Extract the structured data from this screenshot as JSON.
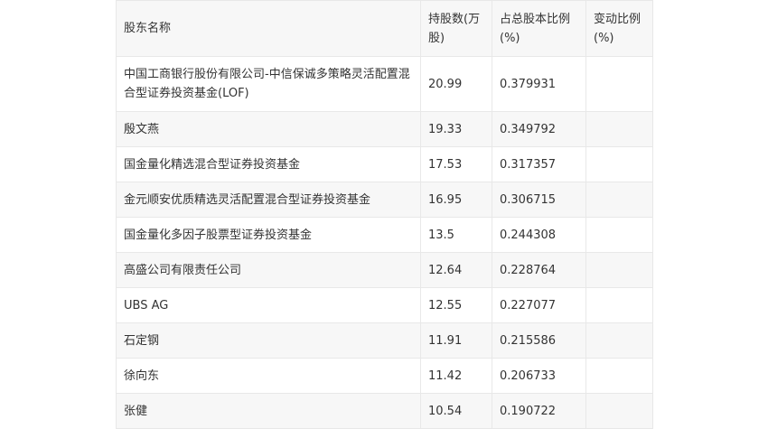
{
  "table": {
    "headers": [
      "股东名称",
      "持股数(万股)",
      "占总股本比例(%)",
      "变动比例(%)"
    ],
    "rows": [
      {
        "name": "中国工商银行股份有限公司-中信保诚多策略灵活配置混合型证券投资基金(LOF)",
        "shares": "20.99",
        "ratio": "0.379931",
        "change": ""
      },
      {
        "name": "殷文燕",
        "shares": "19.33",
        "ratio": "0.349792",
        "change": ""
      },
      {
        "name": "国金量化精选混合型证券投资基金",
        "shares": "17.53",
        "ratio": "0.317357",
        "change": ""
      },
      {
        "name": "金元顺安优质精选灵活配置混合型证券投资基金",
        "shares": "16.95",
        "ratio": "0.306715",
        "change": ""
      },
      {
        "name": "国金量化多因子股票型证券投资基金",
        "shares": "13.5",
        "ratio": "0.244308",
        "change": ""
      },
      {
        "name": "高盛公司有限责任公司",
        "shares": "12.64",
        "ratio": "0.228764",
        "change": ""
      },
      {
        "name": "UBS AG",
        "shares": "12.55",
        "ratio": "0.227077",
        "change": ""
      },
      {
        "name": "石定钢",
        "shares": "11.91",
        "ratio": "0.215586",
        "change": ""
      },
      {
        "name": "徐向东",
        "shares": "11.42",
        "ratio": "0.206733",
        "change": ""
      },
      {
        "name": "张健",
        "shares": "10.54",
        "ratio": "0.190722",
        "change": ""
      }
    ]
  }
}
